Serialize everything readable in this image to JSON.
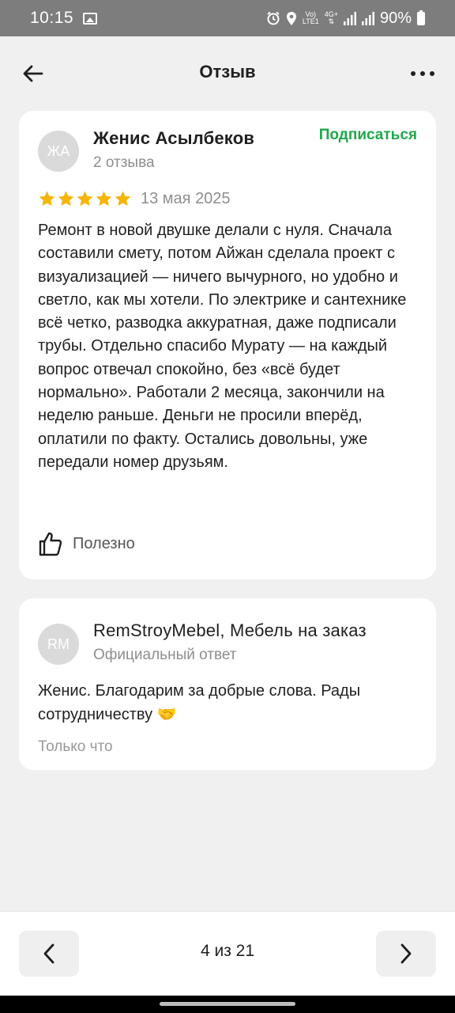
{
  "status_bar": {
    "time": "10:15",
    "battery": "90%",
    "icons": [
      "gallery-icon",
      "alarm-icon",
      "location-icon",
      "volte-icon",
      "4g-icon",
      "signal-icon",
      "signal-icon",
      "battery-icon"
    ]
  },
  "header": {
    "title": "Отзыв"
  },
  "review": {
    "avatar_initials": "ЖА",
    "author": "Женис Асылбеков",
    "reviews_count": "2 отзыва",
    "subscribe_label": "Подписаться",
    "rating": 5,
    "rating_max": 5,
    "date": "13 мая 2025",
    "text": "Ремонт в новой двушке делали с нуля. Сначала составили смету, потом Айжан сделала проект с визуализацией — ничего вычурного, но удобно и светло, как мы хотели. По электрике и сантехнике всё четко, разводка аккуратная, даже подписали трубы. Отдельно спасибо Мурату — на каждый вопрос отвечал спокойно, без «всё будет нормально». Работали 2 месяца, закончили на неделю раньше. Деньги не просили вперёд, оплатили по факту. Остались довольны, уже передали номер друзьям.",
    "helpful_label": "Полезно"
  },
  "reply": {
    "avatar_initials": "RM",
    "company": "RemStroyMebel, Мебель на заказ",
    "label": "Официальный ответ",
    "text": "Женис. Благодарим за добрые слова. Рады сотрудничеству 🤝",
    "time": "Только что"
  },
  "pagination": {
    "counter": "4 из 21"
  },
  "colors": {
    "accent_green": "#1fa84b",
    "star": "#f5b50a",
    "background": "#f0f0f0",
    "card": "#ffffff"
  }
}
